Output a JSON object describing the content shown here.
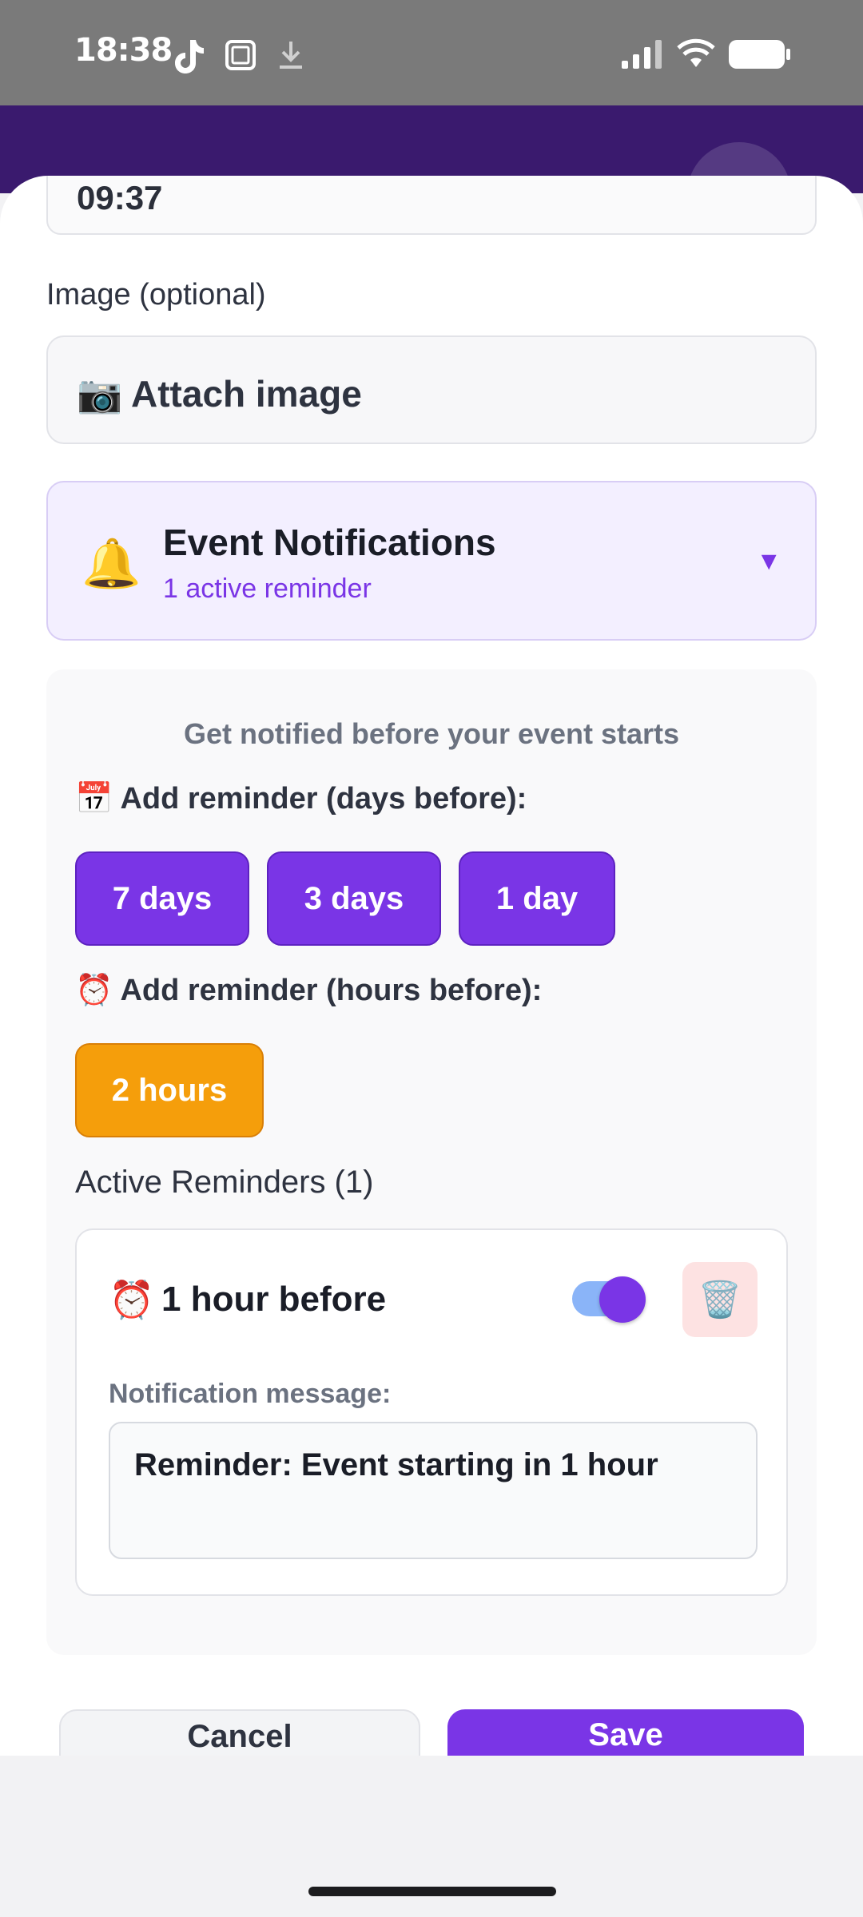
{
  "status_bar": {
    "time": "18:38",
    "icons": [
      "tiktok-icon",
      "screenshot-icon",
      "download-icon",
      "signal-icon",
      "wifi-icon",
      "battery-icon"
    ]
  },
  "form": {
    "time_value": "09:37",
    "image_label": "Image (optional)",
    "attach_icon": "📷",
    "attach_label": "Attach image"
  },
  "notifications": {
    "icon": "🔔",
    "title": "Event Notifications",
    "subtitle": "1 active reminder",
    "caret": "▼",
    "hint": "Get notified before your event starts",
    "days_label": "📅 Add reminder (days before):",
    "day_buttons": [
      "7 days",
      "3 days",
      "1 day"
    ],
    "hours_label": "⏰ Add reminder (hours before):",
    "hour_buttons": [
      "2 hours"
    ],
    "active_title": "Active Reminders (1)",
    "reminders": [
      {
        "icon": "⏰",
        "title": "1 hour before",
        "enabled": true,
        "trash_icon": "🗑️",
        "message_label": "Notification message:",
        "message": "Reminder: Event starting in 1 hour"
      }
    ]
  },
  "footer": {
    "cancel_label": "Cancel",
    "save_label": "Save"
  },
  "colors": {
    "accent": "#7a35e6",
    "header": "#3a1a6e",
    "orange": "#f59e0b"
  }
}
